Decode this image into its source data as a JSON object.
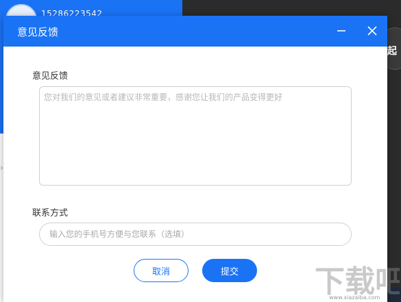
{
  "background": {
    "phone": "15286223542",
    "right_glyph": "起"
  },
  "dialog": {
    "title": "意见反馈",
    "feedback_label": "意见反馈",
    "feedback_placeholder": "您对我们的意见或者建议非常重要，感谢您让我们的产品变得更好",
    "contact_label": "联系方式",
    "contact_placeholder": "输入您的手机号方便与您联系（选填）",
    "cancel_label": "取消",
    "submit_label": "提交"
  },
  "watermark": {
    "text": "下载吧",
    "url": "www.xiazaiba.com"
  },
  "colors": {
    "accent": "#1a73f5",
    "dark_bg": "#2b2b2b"
  },
  "icons": [
    "minimize-icon",
    "close-icon"
  ]
}
